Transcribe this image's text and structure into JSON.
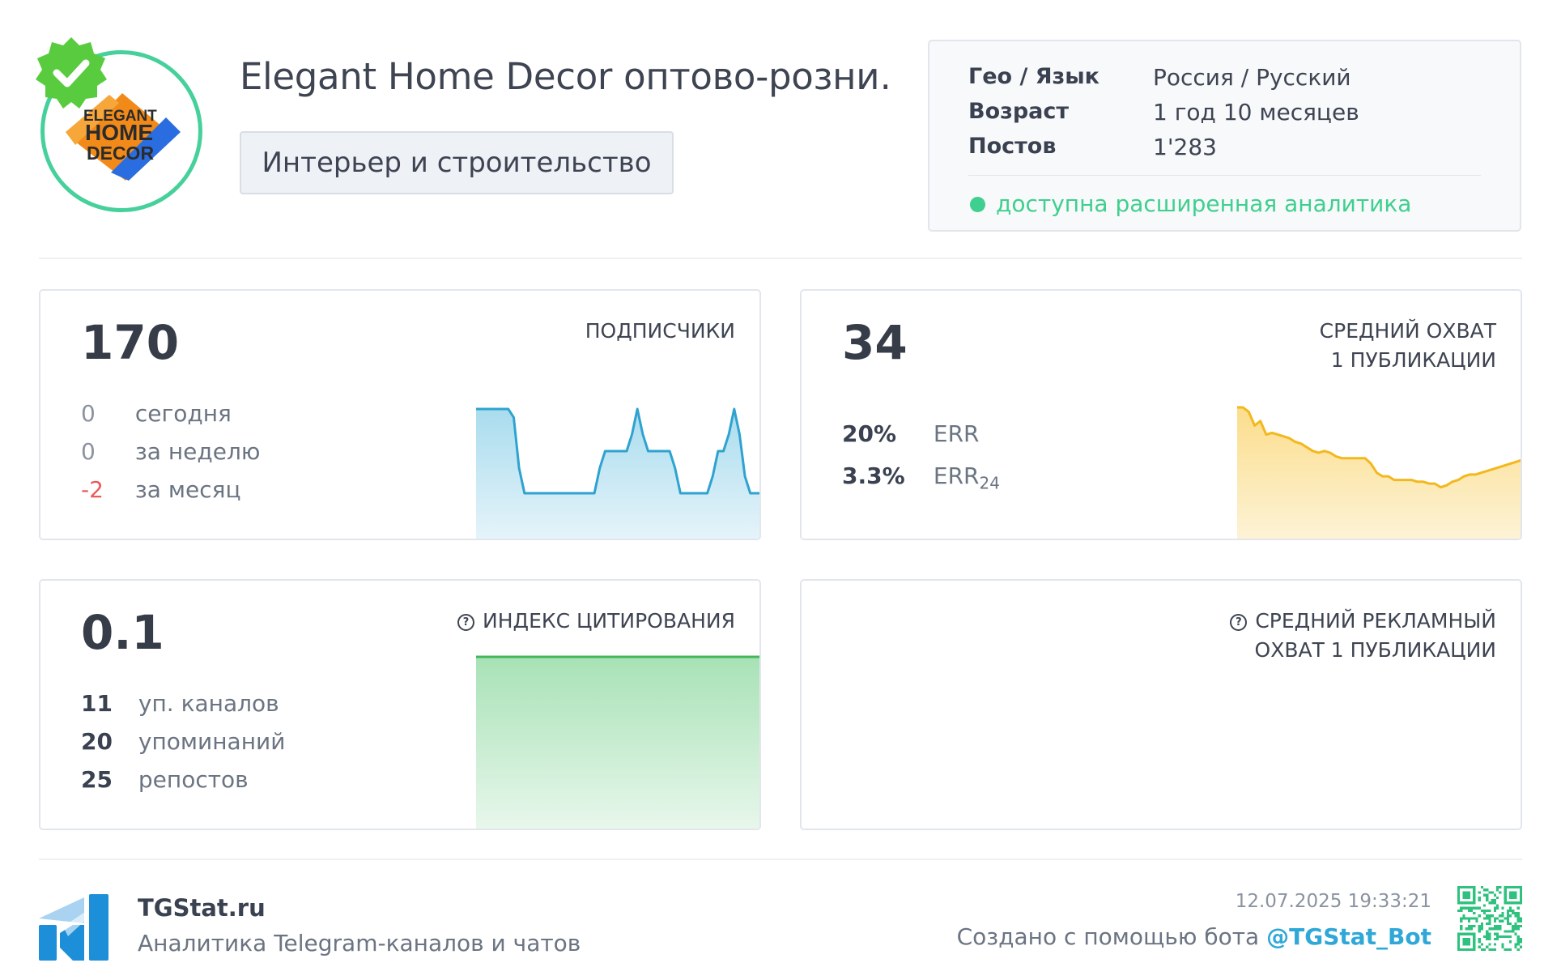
{
  "header": {
    "channel_title": "Elegant Home Decor оптово-розни…",
    "category": "Интерьер и строительство",
    "logo_text": [
      "ELEGANT",
      "HOME",
      "DECOR"
    ],
    "info": {
      "rows": [
        {
          "label": "Гео / Язык",
          "value": "Россия / Русский"
        },
        {
          "label": "Возраст",
          "value": "1 год 10 месяцев"
        },
        {
          "label": "Постов",
          "value": "1'283"
        }
      ],
      "status": "доступна расширенная аналитика"
    }
  },
  "cards": {
    "subscribers": {
      "value": "170",
      "label": "ПОДПИСЧИКИ",
      "stats": [
        {
          "num": "0",
          "text": "сегодня"
        },
        {
          "num": "0",
          "text": "за неделю"
        },
        {
          "num": "-2",
          "text": "за месяц"
        }
      ]
    },
    "reach": {
      "value": "34",
      "label_line1": "СРЕДНИЙ ОХВАТ",
      "label_line2": "1 ПУБЛИКАЦИИ",
      "err": {
        "num": "20%",
        "text": "ERR"
      },
      "err24": {
        "num": "3.3%",
        "text": "ERR",
        "sub": "24"
      }
    },
    "citation": {
      "value": "0.1",
      "label": "ИНДЕКС ЦИТИРОВАНИЯ",
      "stats": [
        {
          "num": "11",
          "text": "уп. каналов"
        },
        {
          "num": "20",
          "text": "упоминаний"
        },
        {
          "num": "25",
          "text": "репостов"
        }
      ]
    },
    "ad_reach": {
      "label_line1": "СРЕДНИЙ РЕКЛАМНЫЙ",
      "label_line2": "ОХВАТ 1 ПУБЛИКАЦИИ"
    }
  },
  "sparklines": {
    "subscribers": [
      1,
      1,
      1,
      1,
      1,
      1,
      1,
      0.9,
      0.3,
      0,
      0,
      0,
      0,
      0,
      0,
      0,
      0,
      0,
      0,
      0,
      0,
      0,
      0,
      0.3,
      0.5,
      0.5,
      0.5,
      0.5,
      0.5,
      0.7,
      1,
      0.7,
      0.5,
      0.5,
      0.5,
      0.5,
      0.5,
      0.3,
      0,
      0,
      0,
      0,
      0,
      0,
      0.2,
      0.5,
      0.5,
      0.7,
      1,
      0.7,
      0.2,
      0,
      0,
      0
    ],
    "reach": [
      1,
      1,
      0.95,
      0.8,
      0.85,
      0.7,
      0.72,
      0.7,
      0.68,
      0.66,
      0.62,
      0.6,
      0.56,
      0.52,
      0.5,
      0.52,
      0.5,
      0.46,
      0.44,
      0.44,
      0.44,
      0.44,
      0.44,
      0.38,
      0.28,
      0.24,
      0.24,
      0.2,
      0.2,
      0.2,
      0.2,
      0.18,
      0.18,
      0.16,
      0.16,
      0.12,
      0.14,
      0.18,
      0.2,
      0.24,
      0.26,
      0.26,
      0.28,
      0.3,
      0.32,
      0.34,
      0.36,
      0.38,
      0.4,
      0.42
    ],
    "citation": [
      1,
      1
    ]
  },
  "colors": {
    "accent_green": "#3fcf8e",
    "subscribers_line": "#2ea3cf",
    "reach_line": "#f2b81d",
    "citation_line": "#42b85a",
    "negative": "#ec5a5a",
    "bot_link": "#2fa8d8"
  },
  "footer": {
    "site": "TGStat.ru",
    "tagline": "Аналитика Telegram-каналов и чатов",
    "timestamp": "12.07.2025 19:33:21",
    "credit_prefix": "Создано с помощью бота",
    "bot": "@TGStat_Bot"
  }
}
